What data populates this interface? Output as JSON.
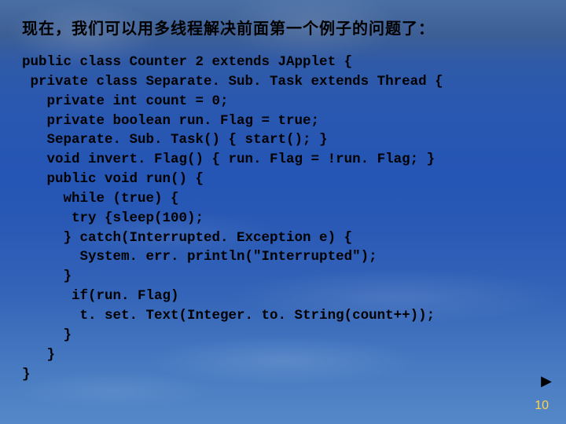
{
  "slide": {
    "title": "现在，我们可以用多线程解决前面第一个例子的问题了：",
    "code": "public class Counter 2 extends JApplet {\n private class Separate. Sub. Task extends Thread {\n   private int count = 0;\n   private boolean run. Flag = true;\n   Separate. Sub. Task() { start(); }\n   void invert. Flag() { run. Flag = !run. Flag; }\n   public void run() {\n     while (true) {\n      try {sleep(100);\n     } catch(Interrupted. Exception e) {\n       System. err. println(\"Interrupted\");\n     }\n      if(run. Flag)\n       t. set. Text(Integer. to. String(count++));\n     }\n   }\n}",
    "arrow_glyph": "▶",
    "page_number": "10"
  }
}
